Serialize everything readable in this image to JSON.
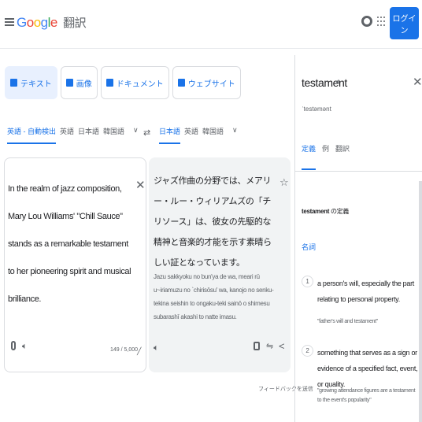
{
  "header": {
    "logo": [
      "G",
      "o",
      "o",
      "g",
      "l",
      "e"
    ],
    "product": "翻訳",
    "login_label": "ログイン"
  },
  "modes": [
    {
      "label": "テキスト",
      "icon": "translate-icon"
    },
    {
      "label": "画像",
      "icon": "image-icon"
    },
    {
      "label": "ドキュメント",
      "icon": "document-icon"
    },
    {
      "label": "ウェブサイト",
      "icon": "website-icon"
    }
  ],
  "source_langs": [
    "英語 - 自動検出",
    "英語",
    "日本語",
    "韓国語"
  ],
  "target_langs": [
    "日本語",
    "英語",
    "韓国語"
  ],
  "source": {
    "text": "In the realm of jazz composition, Mary Lou Williams' \"Chill Sauce\" stands as a remarkable testament to her pioneering spirit and musical brilliance.",
    "counter": "149 / 5,000"
  },
  "target": {
    "text": "ジャズ作曲の分野では、メアリー・ルー・ウィリアムズの「チリソース」は、彼女の先駆的な精神と音楽的才能を示す素晴らしい証となっています。",
    "romaji": "Jazu sakkyoku no bun'ya de wa, meari rū u~iriamuzu no `chirisōsu' wa, kanojo no senku-tekina seishin to ongaku-teki sainō o shimesu subarashī akashi to natte imasu."
  },
  "feedback_label": "フィードバックを送信",
  "dictionary": {
    "word": "testament",
    "phonetic": "ˈtestəmənt",
    "tabs": [
      "定義",
      "例",
      "翻訳"
    ],
    "definition_title_word": "testament",
    "definition_title_suffix": " の定義",
    "pos": "名詞",
    "definitions": [
      {
        "num": "1",
        "text": "a person's will, especially the part relating to personal property.",
        "example": "\"father's will and testament\""
      },
      {
        "num": "2",
        "text": "something that serves as a sign or evidence of a specified fact, event, or quality.",
        "example": "\"growing attendance figures are a testament to the event's popularity\""
      }
    ]
  }
}
